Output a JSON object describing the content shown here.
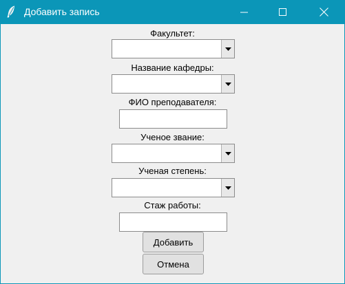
{
  "window": {
    "title": "Добавить запись",
    "icons": {
      "app": "feather-icon",
      "minimize": "minimize-icon",
      "maximize": "maximize-icon",
      "close": "close-icon"
    },
    "colors": {
      "titlebar": "#0b96b8",
      "client": "#f0f0f0",
      "button": "#e1e1e1"
    }
  },
  "form": {
    "faculty_label": "Факультет:",
    "faculty_value": "",
    "department_label": "Название кафедры:",
    "department_value": "",
    "teacher_label": "ФИО преподавателя:",
    "teacher_value": "",
    "academic_title_label": "Ученое звание:",
    "academic_title_value": "",
    "academic_degree_label": "Ученая степень:",
    "academic_degree_value": "",
    "experience_label": "Стаж работы:",
    "experience_value": ""
  },
  "buttons": {
    "add": "Добавить",
    "cancel": "Отмена"
  }
}
